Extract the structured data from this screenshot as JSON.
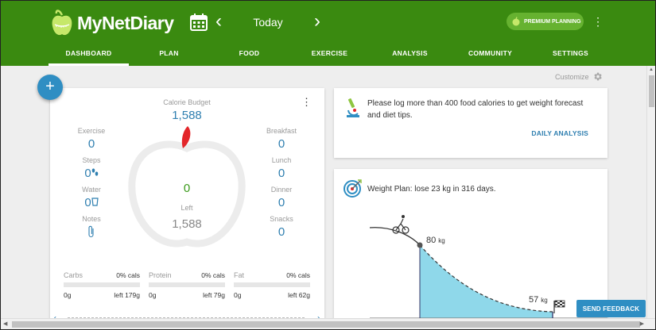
{
  "header": {
    "app_name": "MyNetDiary",
    "date_label": "Today",
    "prev_arrow": "‹",
    "next_arrow": "›",
    "premium_label": "PREMIUM PLANNING",
    "more_icon": "⋮"
  },
  "tabs": [
    {
      "label": "DASHBOARD",
      "active": true
    },
    {
      "label": "PLAN"
    },
    {
      "label": "FOOD"
    },
    {
      "label": "EXERCISE"
    },
    {
      "label": "ANALYSIS"
    },
    {
      "label": "COMMUNITY"
    },
    {
      "label": "SETTINGS"
    }
  ],
  "customize_label": "Customize",
  "fab_label": "+",
  "calorie_card": {
    "budget_label": "Calorie Budget",
    "budget_value": "1,588",
    "center_value": "0",
    "left_label": "Left",
    "left_value": "1,588",
    "left_stats": [
      {
        "label": "Exercise",
        "value": "0"
      },
      {
        "label": "Steps",
        "value": "0"
      },
      {
        "label": "Water",
        "value": "0"
      },
      {
        "label": "Notes",
        "value": ""
      }
    ],
    "right_stats": [
      {
        "label": "Breakfast",
        "value": "0"
      },
      {
        "label": "Lunch",
        "value": "0"
      },
      {
        "label": "Dinner",
        "value": "0"
      },
      {
        "label": "Snacks",
        "value": "0"
      }
    ],
    "macros": [
      {
        "name": "Carbs",
        "pct": "0% cals",
        "eaten": "0g",
        "left": "left 179g"
      },
      {
        "name": "Protein",
        "pct": "0% cals",
        "eaten": "0g",
        "left": "left 79g"
      },
      {
        "name": "Fat",
        "pct": "0% cals",
        "eaten": "0g",
        "left": "left 62g"
      }
    ],
    "pager_prev": "‹",
    "pager_next": "›"
  },
  "tip_card": {
    "text": "Please log more than 400 food calories to get weight forecast and diet tips.",
    "link_label": "DAILY ANALYSIS"
  },
  "weight_card": {
    "title": "Weight Plan: lose 23 kg in 316 days.",
    "start_value": "80",
    "start_unit": "kg",
    "goal_value": "57",
    "goal_unit": "kg"
  },
  "feedback_label": "SEND FEEDBACK",
  "colors": {
    "header_green": "#3a8a10",
    "accent_blue": "#2f8ec3",
    "apple_red": "#e3262a"
  }
}
